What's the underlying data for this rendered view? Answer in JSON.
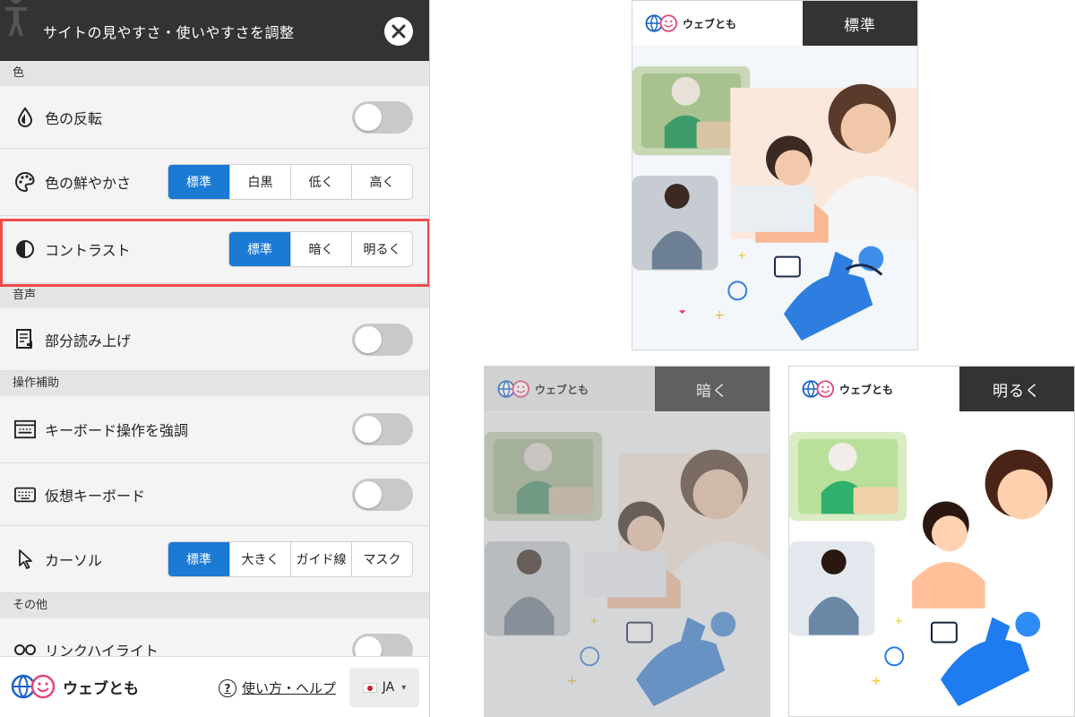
{
  "panel": {
    "title": "サイトの見やすさ・使いやすさを調整",
    "sections": {
      "color": "色",
      "sound": "音声",
      "assist": "操作補助",
      "other": "その他"
    },
    "rows": {
      "invert": "色の反転",
      "saturation": "色の鮮やかさ",
      "contrast": "コントラスト",
      "read_aloud": "部分読み上げ",
      "keyboard_emphasis": "キーボード操作を強調",
      "virtual_keyboard": "仮想キーボード",
      "cursor": "カーソル",
      "partial_other": "リンクハイライト"
    },
    "saturation_options": [
      "標準",
      "白黒",
      "低く",
      "高く"
    ],
    "contrast_options": [
      "標準",
      "暗く",
      "明るく"
    ],
    "cursor_options": [
      "標準",
      "大きく",
      "ガイド線",
      "マスク"
    ],
    "footer": {
      "brand": "ウェブとも",
      "help": "使い方・ヘルプ",
      "language": "JA"
    }
  },
  "previews": {
    "brand": "ウェブとも",
    "standard_tag": "標準",
    "dark_tag": "暗く",
    "bright_tag": "明るく"
  },
  "colors": {
    "accent": "#1a7ad4",
    "header": "#333333",
    "highlight": "#ee4b4b"
  }
}
